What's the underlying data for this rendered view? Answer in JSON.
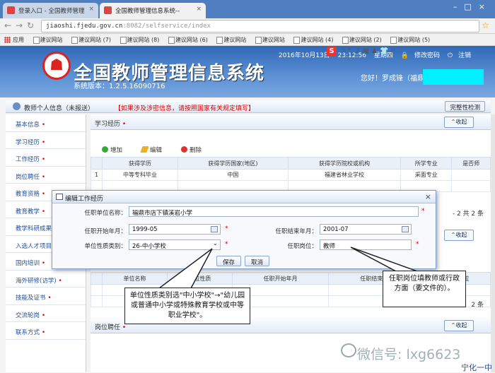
{
  "browser": {
    "tabs": [
      {
        "label": "登录入口 - 全国教师管理"
      },
      {
        "label": "全国教师管理信息系统--"
      }
    ],
    "url_host": "jiaoshi.fjedu.gov.cn",
    "url_rest": ":8082/selfservice/index",
    "bookmarks": [
      "应用",
      "建议网站",
      "建议网站 (7)",
      "建议网站 (8)",
      "建议网站 (6)",
      "建议网站",
      "建议网站",
      "建议网站 (4)",
      "建议网站 (2)",
      "建议网站 (5)"
    ]
  },
  "header": {
    "logo_glyph": "☗",
    "title": "全国教师管理信息系统",
    "version": "系统版本：1.2.5.16090716",
    "date": "2016年10月13日",
    "time": "23:12:56",
    "weekday": "星期四",
    "change_password": "修改密码",
    "logout": "注销",
    "welcome": "您好！罗成锋（福鼎"
  },
  "person_bar": {
    "title": "教师个人信息（未报送）",
    "warning": "【如果涉及涉密信息，请按照国家有关规定填写】",
    "full_info_button": "完整性检测"
  },
  "sidebar": {
    "items": [
      {
        "label": "基本信息"
      },
      {
        "label": "学习经历"
      },
      {
        "label": "工作经历"
      },
      {
        "label": "岗位聘任"
      },
      {
        "label": "教育资格"
      },
      {
        "label": "教育教学"
      },
      {
        "label": "教学科研成果"
      },
      {
        "label": "入选人才项目"
      },
      {
        "label": "国内培训"
      },
      {
        "label": "海外研修(访学)"
      },
      {
        "label": "技能及证书"
      },
      {
        "label": "交流轮岗"
      },
      {
        "label": "联系方式"
      }
    ]
  },
  "main": {
    "section_study": "学习经历",
    "collapse": "收起",
    "add": "增加",
    "edit": "编辑",
    "delete": "删除",
    "study_headers": [
      "",
      "获得学历",
      "获得学历国家(地区)",
      "获得学历院校或机构",
      "所学专业",
      "是否师"
    ],
    "study_row": [
      "1",
      "中等专科毕业",
      "中国",
      "福建省林业学校",
      "采面专业",
      ""
    ],
    "pager": "- 2 共 2 条",
    "work_headers": [
      "",
      "单位名称",
      "单位性质",
      "任职开始年月",
      "任职结束年月",
      "任职岗位"
    ],
    "bottom_pager": "2 条",
    "section_post": "岗位聘任"
  },
  "dialog": {
    "title": "编辑工作经历",
    "unit_name_label": "任职单位名称：",
    "unit_name_value": "福鼎市店下镇溪岩小学",
    "start_label": "任职开始年月：",
    "start_value": "1999-05",
    "end_label": "任职结束年月：",
    "end_value": "2001-07",
    "unit_type_label": "单位性质类别：",
    "unit_type_value": "26-中小学校",
    "post_label": "任职岗位：",
    "post_value": "教师",
    "required_mark": "*",
    "save": "保存",
    "cancel": "取消"
  },
  "callouts": {
    "left": "单位性质类别选\"中小学校\"→\"幼儿园或普通中小学或特殊教育学校或中等职业学校\"。",
    "right": "任职岗位填教师或行政方面（要文件的）。"
  },
  "watermark": "微信号: lxg6623",
  "corner_text": "宁化一中"
}
